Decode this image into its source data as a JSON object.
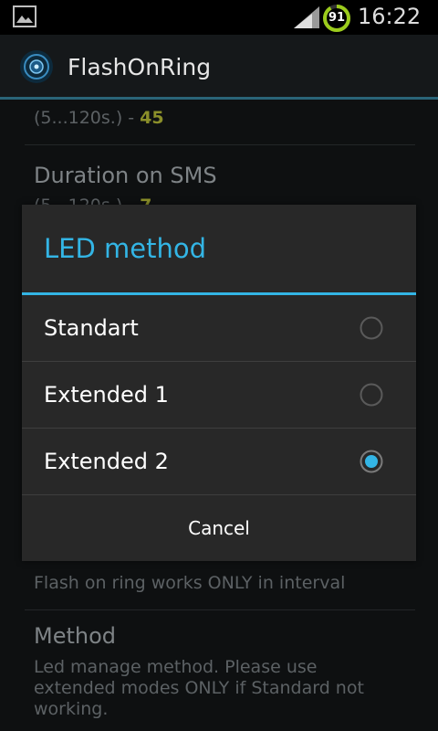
{
  "status_bar": {
    "time": "16:22",
    "battery_level": "91",
    "icons": [
      "image-notification-icon",
      "signal-icon",
      "battery-icon"
    ]
  },
  "action_bar": {
    "app_title": "FlashOnRing",
    "app_icon": "flashonring-app-icon"
  },
  "background_prefs": [
    {
      "summary_prefix": "(5...120s.) - ",
      "value": "45"
    },
    {
      "title": "Duration on SMS",
      "summary_prefix": "(5...120s.) - ",
      "value": "7"
    },
    {
      "summary": "Flash on ring works ONLY in interval"
    },
    {
      "title": "Method",
      "summary": "Led manage method. Please use extended modes ONLY if Standard not working."
    }
  ],
  "dialog": {
    "title": "LED method",
    "options": [
      {
        "label": "Standart",
        "selected": false
      },
      {
        "label": "Extended 1",
        "selected": false
      },
      {
        "label": "Extended 2",
        "selected": true
      }
    ],
    "cancel_label": "Cancel"
  },
  "colors": {
    "accent": "#33b5e5",
    "dialog_bg": "#282828",
    "value_highlight": "#8b8f2a"
  }
}
